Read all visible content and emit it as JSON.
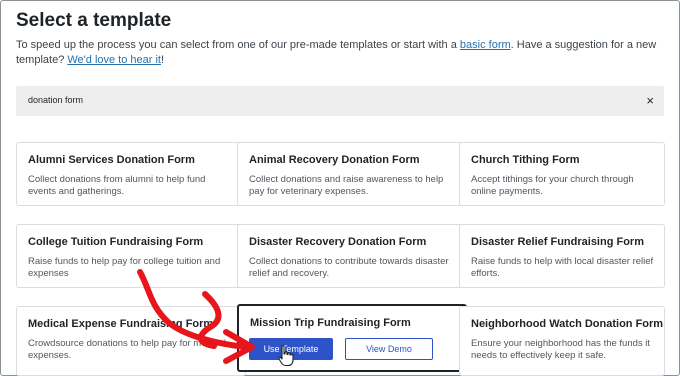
{
  "header": {
    "title": "Select a template",
    "desc_before": "To speed up the process you can select from one of our pre-made templates or start with a ",
    "desc_link": "basic form",
    "desc_middle": ". Have a suggestion for a new template? ",
    "desc_link2": "We'd love to hear it",
    "desc_after": "!"
  },
  "search": {
    "value": "donation form",
    "clear": "×"
  },
  "cards": [
    {
      "title": "Alumni Services Donation Form",
      "desc": "Collect donations from alumni to help fund events and gatherings."
    },
    {
      "title": "Animal Recovery Donation Form",
      "desc": "Collect donations and raise awareness to help pay for veterinary expenses."
    },
    {
      "title": "Church Tithing Form",
      "desc": "Accept tithings for your church through online payments."
    },
    {
      "title": "College Tuition Fundraising Form",
      "desc": "Raise funds to help pay for college tuition and expenses"
    },
    {
      "title": "Disaster Recovery Donation Form",
      "desc": "Collect donations to contribute towards disaster relief and recovery."
    },
    {
      "title": "Disaster Relief Fundraising Form",
      "desc": "Raise funds to help with local disaster relief efforts."
    },
    {
      "title": "Medical Expense Fundraising Form",
      "desc": "Crowdsource donations to help pay for medical expenses."
    },
    {
      "title": "Mission Trip Fundraising Form",
      "desc": ""
    },
    {
      "title": "Neighborhood Watch Donation Form",
      "desc": "Ensure your neighborhood has the funds it needs to effectively keep it safe."
    }
  ],
  "active_card": {
    "use_label": "Use Template",
    "demo_label": "View Demo"
  },
  "colors": {
    "accent": "#2e52c8",
    "annotation": "#e8151b",
    "link": "#2271b1"
  },
  "icons": {
    "clear": "close-icon",
    "cursor": "hand-pointer-icon",
    "annotation": "red-arrow-annotation"
  }
}
